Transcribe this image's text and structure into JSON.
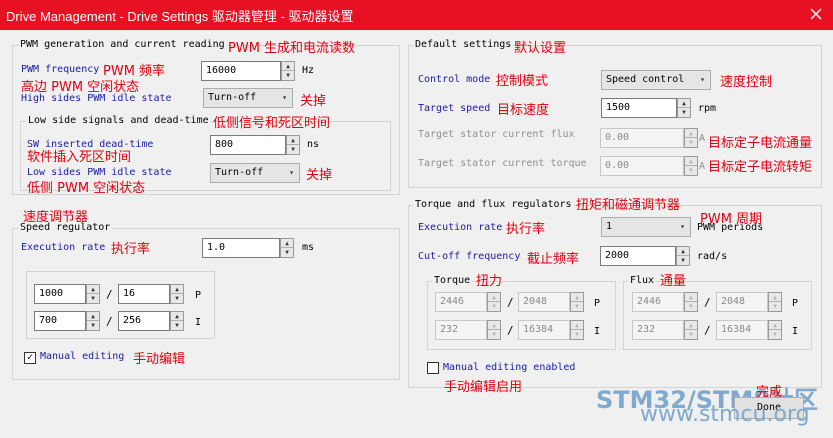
{
  "window": {
    "title": "Drive Management - Drive Settings 驱动器管理 - 驱动器设置"
  },
  "pwm_group": {
    "title": "PWM generation and current reading",
    "title_cn": "PWM 生成和电流读数",
    "freq_label": "PWM frequency",
    "freq_cn": "PWM 频率",
    "freq_value": "16000",
    "freq_unit": "Hz",
    "high_idle_cn": "高边 PWM 空闲状态",
    "high_idle_label": "High sides PWM idle state",
    "high_idle_value": "Turn-off",
    "high_idle_value_cn": "关掉",
    "low_side": {
      "title": "Low side signals and dead-time",
      "title_cn": "低侧信号和死区时间",
      "deadtime_label": "SW inserted dead-time",
      "deadtime_value": "800",
      "deadtime_unit": "ns",
      "deadtime_cn": "软件插入死区时间",
      "low_idle_label": "Low sides PWM idle state",
      "low_idle_value": "Turn-off",
      "low_idle_value_cn": "关掉",
      "low_idle_cn": "低侧 PWM 空闲状态"
    }
  },
  "speed_group": {
    "title_cn": "速度调节器",
    "title": "Speed regulator",
    "exec_label": "Execution rate",
    "exec_cn": "执行率",
    "exec_value": "1.0",
    "exec_unit": "ms",
    "p_num": "1000",
    "p_den": "16",
    "p_label": "P",
    "i_num": "700",
    "i_den": "256",
    "i_label": "I",
    "manual_checked": true,
    "check_mark": "✓",
    "manual_label": "Manual editing",
    "manual_cn": "手动编辑"
  },
  "default_group": {
    "title": "Default settings",
    "title_cn": "默认设置",
    "control_mode_label": "Control mode",
    "control_mode_cn": "控制模式",
    "control_mode_value": "Speed control",
    "control_mode_value_cn": "速度控制",
    "target_speed_label": "Target speed",
    "target_speed_cn": "目标速度",
    "target_speed_value": "1500",
    "target_speed_unit": "rpm",
    "flux_label": "Target stator current flux",
    "flux_value": "0.00",
    "flux_unit": "A",
    "flux_cn": "目标定子电流通量",
    "torque_label": "Target stator current torque",
    "torque_value": "0.00",
    "torque_unit": "A",
    "torque_cn": "目标定子电流转矩"
  },
  "tf_group": {
    "title": "Torque and flux regulators",
    "title_cn": "扭矩和磁通调节器",
    "exec_label": "Execution rate",
    "exec_cn": "执行率",
    "exec_value": "1",
    "exec_unit": "PWM periods",
    "exec_unit_cn": "PWM 周期",
    "cutoff_label": "Cut-off frequency",
    "cutoff_cn": "截止频率",
    "cutoff_value": "2000",
    "cutoff_unit": "rad/s",
    "torque": {
      "title": "Torque",
      "title_cn": "扭力",
      "p_num": "2446",
      "p_den": "2048",
      "p_label": "P",
      "i_num": "232",
      "i_den": "16384",
      "i_label": "I"
    },
    "flux": {
      "title": "Flux",
      "title_cn": "通量",
      "p_num": "2446",
      "p_den": "2048",
      "p_label": "P",
      "i_num": "232",
      "i_den": "16384",
      "i_label": "I"
    },
    "manual_checked": false,
    "manual_label": "Manual editing enabled",
    "manual_cn": "手动编辑启用"
  },
  "footer": {
    "done_cn": "完成",
    "done_label": "Done",
    "watermark_main": "STM32/STM8社区",
    "watermark_url": "www.stmcu.org"
  },
  "colors": {
    "title_bar": "#e81123",
    "annotation": "#e3000f",
    "label_blue": "#1a1aa6"
  },
  "icons": {
    "close": "close-icon",
    "spin": "spin-arrows-icon",
    "dropdown": "chevron-down-icon",
    "check": "check-icon"
  }
}
